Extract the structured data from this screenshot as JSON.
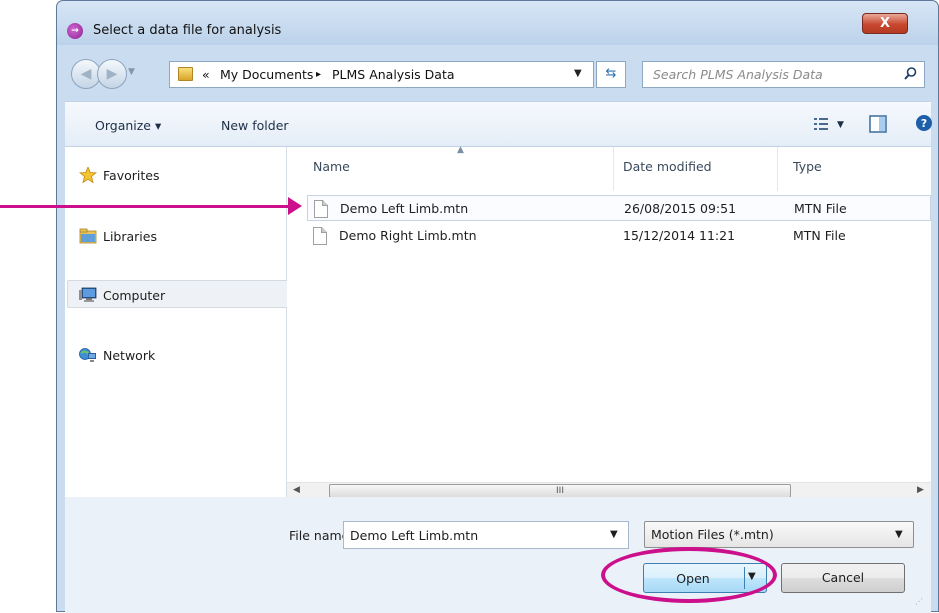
{
  "window": {
    "title": "Select a data file for analysis",
    "close_label": "X",
    "app_icon_glyph": "→"
  },
  "address": {
    "crumb_prefix": "«",
    "crumbs": [
      "My Documents",
      "PLMS Analysis Data"
    ],
    "separator": "▸",
    "search_placeholder": "Search PLMS Analysis Data"
  },
  "toolbar": {
    "organize_label": "Organize ▾",
    "new_folder_label": "New folder"
  },
  "sidebar": {
    "items": [
      {
        "label": "Favorites",
        "icon": "star-icon"
      },
      {
        "label": "Libraries",
        "icon": "libraries-icon"
      },
      {
        "label": "Computer",
        "icon": "computer-icon",
        "selected": true
      },
      {
        "label": "Network",
        "icon": "network-icon"
      }
    ]
  },
  "files": {
    "columns": [
      "Name",
      "Date modified",
      "Type"
    ],
    "rows": [
      {
        "name": "Demo Left Limb.mtn",
        "date": "26/08/2015 09:51",
        "type": "MTN File",
        "selected": true
      },
      {
        "name": "Demo Right Limb.mtn",
        "date": "15/12/2014 11:21",
        "type": "MTN File",
        "selected": false
      }
    ],
    "scroll_thumb_label": "III"
  },
  "footer": {
    "file_name_label": "File name:",
    "file_name_value": "Demo Left Limb.mtn",
    "file_type_value": "Motion Files (*.mtn)",
    "open_label": "Open",
    "cancel_label": "Cancel"
  },
  "colors": {
    "annotation": "#cc0f8a",
    "frame": "#c9dcf0",
    "accent": "#3c7fb1"
  }
}
